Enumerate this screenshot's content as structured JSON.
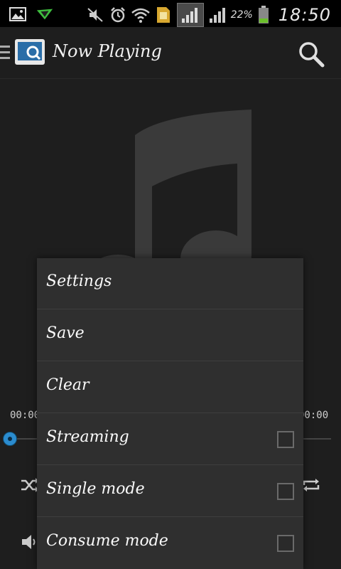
{
  "status_bar": {
    "icons_left": [
      "image-icon",
      "download-arrow-icon"
    ],
    "icons_right": [
      "mute-icon",
      "alarm-icon",
      "wifi-icon",
      "sim-icon",
      "signal-icon",
      "signal-icon-2",
      "battery-icon"
    ],
    "battery_percent": "22%",
    "time": "18:50"
  },
  "action_bar": {
    "title": "Now Playing"
  },
  "player": {
    "elapsed": "00:00",
    "duration": "00:00",
    "progress": 0
  },
  "menu": {
    "items": [
      {
        "label": "Settings"
      },
      {
        "label": "Save"
      },
      {
        "label": "Clear"
      },
      {
        "label": "Streaming",
        "checked": false
      },
      {
        "label": "Single mode",
        "checked": false
      },
      {
        "label": "Consume mode",
        "checked": false
      }
    ]
  },
  "colors": {
    "background": "#1e1e1e",
    "menu_background": "#2f2f2f",
    "accent": "#2b8ccf",
    "battery": "#6bbf2b"
  }
}
